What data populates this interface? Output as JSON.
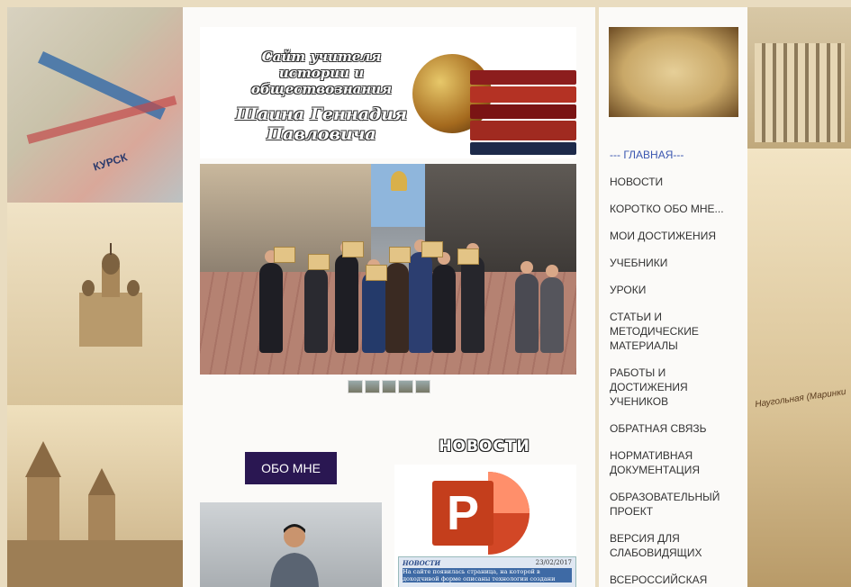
{
  "banner": {
    "line1": "Сайт учителя истории и обществознания",
    "line2": "Шаина Геннадия Павловича"
  },
  "left_map": {
    "label": "КУРСК"
  },
  "right_caption": "Наугольная (Маринки",
  "about": {
    "label": "ОБО МНЕ"
  },
  "news": {
    "heading": "НОВОСТИ",
    "card_tag": "НОВОСТИ",
    "card_date": "23/02/2017",
    "card_text": "На сайте появилась страница, на которой в доходчивой форме описаны технологии создани"
  },
  "nav": {
    "items": [
      {
        "label": "--- ГЛАВНАЯ---",
        "active": true
      },
      {
        "label": "НОВОСТИ"
      },
      {
        "label": "КОРОТКО ОБО МНЕ..."
      },
      {
        "label": "МОИ ДОСТИЖЕНИЯ"
      },
      {
        "label": "УЧЕБНИКИ"
      },
      {
        "label": "УРОКИ"
      },
      {
        "label": "СТАТЬИ И МЕТОДИЧЕСКИЕ МАТЕРИАЛЫ"
      },
      {
        "label": "РАБОТЫ И ДОСТИЖЕНИЯ УЧЕНИКОВ"
      },
      {
        "label": "ОБРАТНАЯ СВЯЗЬ"
      },
      {
        "label": "НОРМАТИВНАЯ ДОКУМЕНТАЦИЯ"
      },
      {
        "label": "ОБРАЗОВАТЕЛЬНЫЙ ПРОЕКТ"
      },
      {
        "label": "ВЕРСИЯ ДЛЯ СЛАБОВИДЯЩИХ"
      },
      {
        "label": "ВСЕРОССИЙСКАЯ"
      }
    ]
  },
  "slider": {
    "thumb_count": 5
  },
  "colors": {
    "accent": "#2a1752",
    "nav_active": "#3a56b0",
    "nav_text": "#333333",
    "panel_bg": "#fbfaf8"
  }
}
